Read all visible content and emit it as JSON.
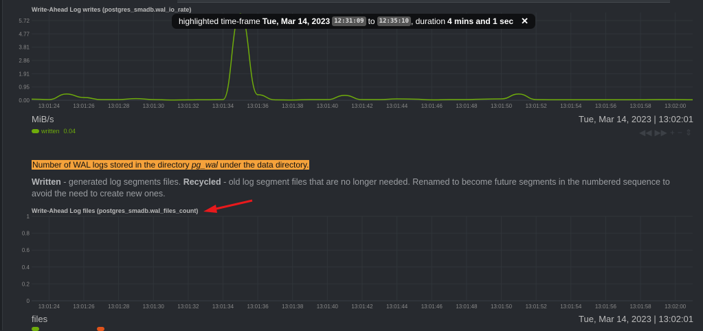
{
  "tooltip": {
    "prefix": "highlighted time-frame",
    "date": "Tue, Mar 14, 2023",
    "from": "12:31:09",
    "to_word": "to",
    "to": "12:35:10",
    "duration_prefix": ", duration",
    "duration": "4 mins and 1 sec",
    "close_icon": "close-icon"
  },
  "chart1": {
    "title": "Write-Ahead Log writes (postgres_smadb.wal_io_rate)",
    "units": "MiB/s",
    "latest": "Tue, Mar 14, 2023 | 13:02:01",
    "legend": [
      {
        "name": "written",
        "value": "0.04",
        "color": "#6fac0b"
      }
    ]
  },
  "controls": [
    "pan-left-icon",
    "pan-right-icon",
    "zoom-in-icon",
    "zoom-out-icon",
    "resize-icon"
  ],
  "description": {
    "highlight_pre": "Number of WAL logs stored in the directory ",
    "highlight_em": "pg_wal",
    "highlight_post": " under the data directory.",
    "written_label": "Written",
    "written_text": " - generated log segments files. ",
    "recycled_label": "Recycled",
    "recycled_text": " - old log segment files that are no longer needed. Renamed to become future segments in the numbered sequence to avoid the need to create new ones."
  },
  "chart2": {
    "title": "Write-Ahead Log files (postgres_smadb.wal_files_count)",
    "units": "files",
    "latest": "Tue, Mar 14, 2023 | 13:02:01",
    "legend_colors": [
      "#6fac0b",
      "#e0531b"
    ]
  },
  "chart_data": [
    {
      "type": "line",
      "title": "Write-Ahead Log writes (postgres_smadb.wal_io_rate)",
      "ylabel": "MiB/s",
      "x_start": "13:01:23",
      "x_end": "13:02:01",
      "x_ticks": [
        "13:01:24",
        "13:01:26",
        "13:01:28",
        "13:01:30",
        "13:01:32",
        "13:01:34",
        "13:01:36",
        "13:01:38",
        "13:01:40",
        "13:01:42",
        "13:01:44",
        "13:01:46",
        "13:01:48",
        "13:01:50",
        "13:01:52",
        "13:01:54",
        "13:01:56",
        "13:01:58",
        "13:02:00"
      ],
      "y_ticks": [
        "0.00",
        "0.95",
        "1.91",
        "2.86",
        "3.81",
        "4.77",
        "5.72"
      ],
      "ylim": [
        0,
        6.3
      ],
      "grid": true,
      "series": [
        {
          "name": "written",
          "color": "#6fac0b",
          "values": [
            0.08,
            0.05,
            0.45,
            0.2,
            0.05,
            0.05,
            0.12,
            0.05,
            0.02,
            0.03,
            0.04,
            0.05,
            6.2,
            0.4,
            0.03,
            0.02,
            0.05,
            0.05,
            0.35,
            0.05,
            0.05,
            0.1,
            0.08,
            0.03,
            0.05,
            0.05,
            0.08,
            0.1,
            0.45,
            0.05,
            0.04,
            0.04,
            0.04,
            0.04,
            0.04,
            0.04,
            0.05,
            0.05,
            0.04
          ]
        }
      ]
    },
    {
      "type": "line",
      "title": "Write-Ahead Log files (postgres_smadb.wal_files_count)",
      "ylabel": "files",
      "x_start": "13:01:23",
      "x_end": "13:02:01",
      "x_ticks": [
        "13:01:24",
        "13:01:26",
        "13:01:28",
        "13:01:30",
        "13:01:32",
        "13:01:34",
        "13:01:36",
        "13:01:38",
        "13:01:40",
        "13:01:42",
        "13:01:44",
        "13:01:46",
        "13:01:48",
        "13:01:50",
        "13:01:52",
        "13:01:54",
        "13:01:56",
        "13:01:58",
        "13:02:00"
      ],
      "y_ticks": [
        "0",
        "0.2",
        "0.4",
        "0.6",
        "0.8",
        "1"
      ],
      "ylim": [
        0,
        1
      ],
      "grid": true,
      "series": []
    }
  ]
}
